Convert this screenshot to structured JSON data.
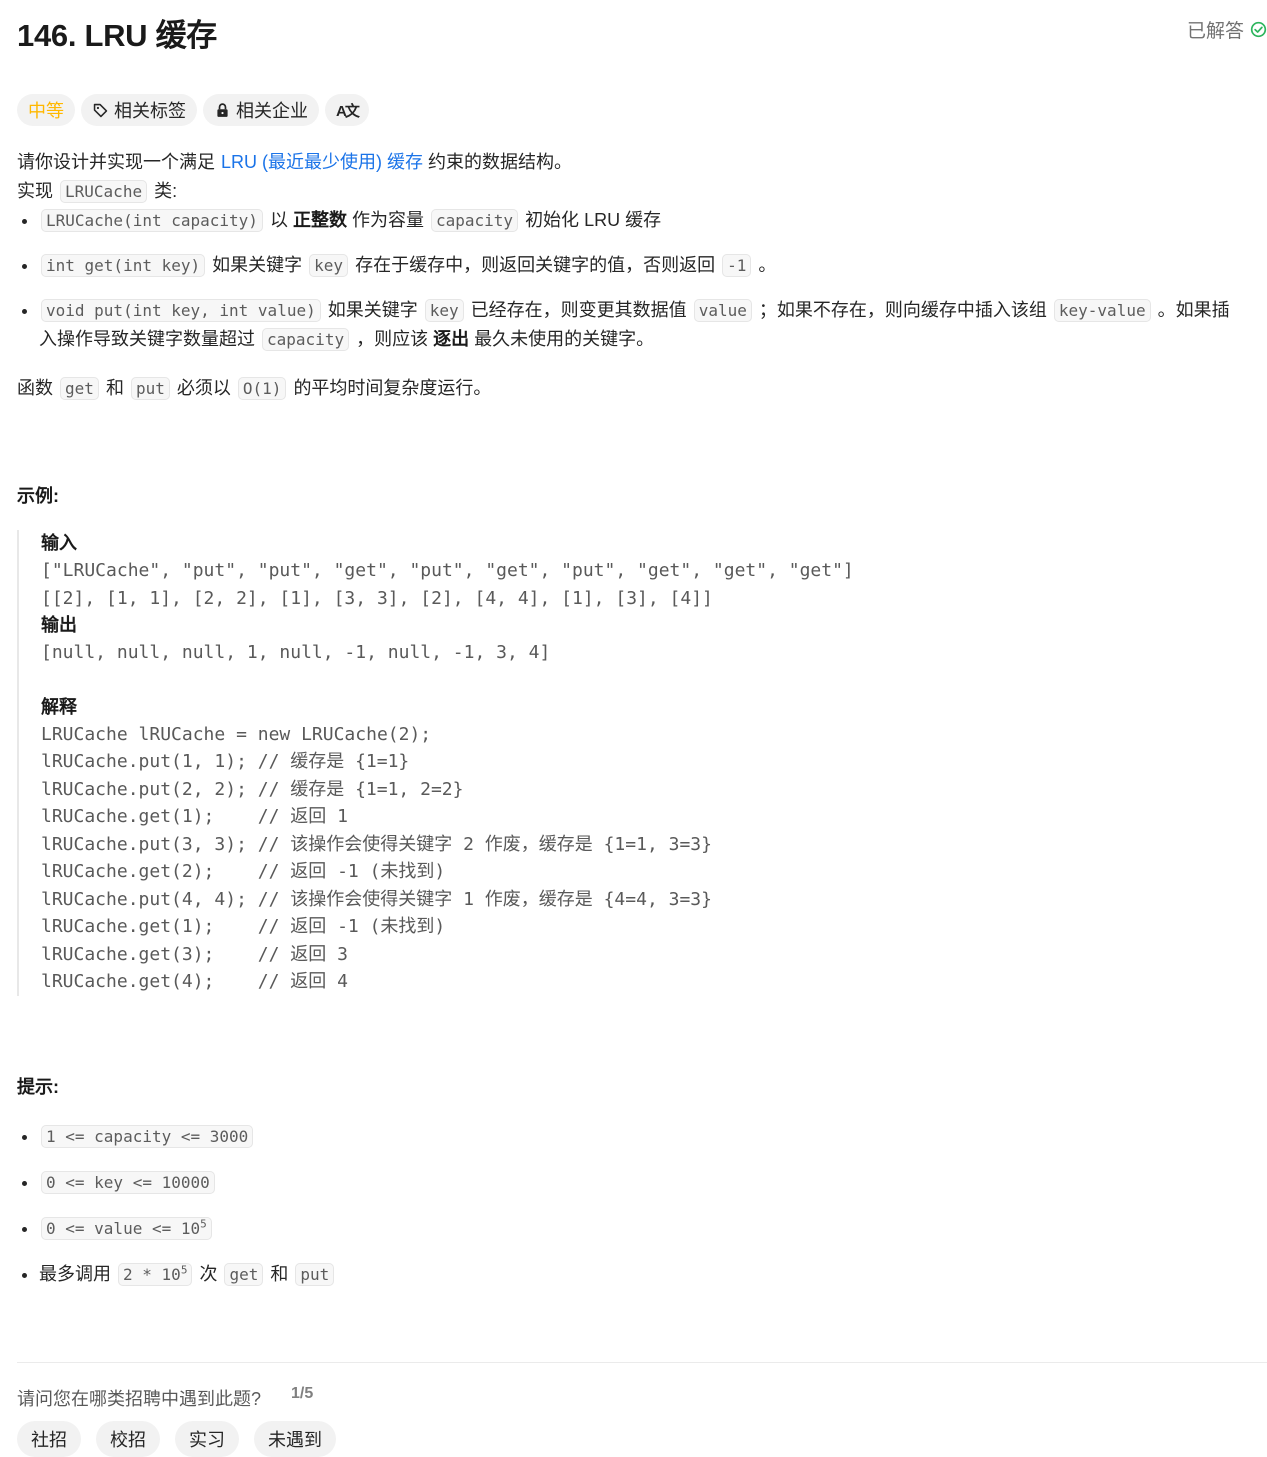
{
  "header": {
    "title": "146. LRU 缓存",
    "status_label": "已解答",
    "status_color": "#2db55d"
  },
  "tags": {
    "difficulty": "中等",
    "difficulty_color": "#ffb800",
    "topics": "相关标签",
    "companies": "相关企业",
    "translate_icon_text": "A文"
  },
  "description": {
    "intro_before": "请你设计并实现一个满足",
    "intro_link": "LRU (最近最少使用) 缓存",
    "intro_after": "约束的数据结构。",
    "impl_before": "实现",
    "impl_code": "LRUCache",
    "impl_after": "类:",
    "items": [
      {
        "code1": "LRUCache(int capacity)",
        "t1": "以",
        "bold": "正整数",
        "t2": "作为容量",
        "code2": "capacity",
        "t3": "初始化 LRU 缓存"
      },
      {
        "code1": "int get(int key)",
        "t1": "如果关键字",
        "code2": "key",
        "t2": "存在于缓存中，则返回关键字的值，否则返回",
        "code3": "-1",
        "t3": "。"
      },
      {
        "code1": "void put(int key, int value)",
        "t1": "如果关键字",
        "code2": "key",
        "t2": "已经存在，则变更其数据值",
        "code3": "value",
        "t3": "；如果不存在，则向缓存中插入该组",
        "code4": "key-value",
        "t4": "。如果插入操作导致关键字数量超过",
        "code5": "capacity",
        "t5": "，则应该",
        "bold": "逐出",
        "t6": "最久未使用的关键字。"
      }
    ],
    "complexity": {
      "t1": "函数",
      "code1": "get",
      "t2": "和",
      "code2": "put",
      "t3": "必须以",
      "code3": "O(1)",
      "t4": "的平均时间复杂度运行。"
    }
  },
  "example": {
    "heading": "示例:",
    "input_label": "输入",
    "input_lines": [
      "[\"LRUCache\", \"put\", \"put\", \"get\", \"put\", \"get\", \"put\", \"get\", \"get\", \"get\"]",
      "[[2], [1, 1], [2, 2], [1], [3, 3], [2], [4, 4], [1], [3], [4]]"
    ],
    "output_label": "输出",
    "output_line": "[null, null, null, 1, null, -1, null, -1, 3, 4]",
    "explain_label": "解释",
    "explain_lines": [
      "LRUCache lRUCache = new LRUCache(2);",
      "lRUCache.put(1, 1); // 缓存是 {1=1}",
      "lRUCache.put(2, 2); // 缓存是 {1=1, 2=2}",
      "lRUCache.get(1);    // 返回 1",
      "lRUCache.put(3, 3); // 该操作会使得关键字 2 作废，缓存是 {1=1, 3=3}",
      "lRUCache.get(2);    // 返回 -1 (未找到)",
      "lRUCache.put(4, 4); // 该操作会使得关键字 1 作废，缓存是 {4=4, 3=3}",
      "lRUCache.get(1);    // 返回 -1 (未找到)",
      "lRUCache.get(3);    // 返回 3",
      "lRUCache.get(4);    // 返回 4"
    ]
  },
  "hints": {
    "heading": "提示:",
    "c1": "1 <= capacity <= 3000",
    "c2": "0 <= key <= 10000",
    "c3_base": "0 <= value <= 10",
    "c3_exp": "5",
    "c4_t1": "最多调用",
    "c4_code_base": "2 * 10",
    "c4_code_exp": "5",
    "c4_t2": "次",
    "c4_code2": "get",
    "c4_t3": "和",
    "c4_code3": "put"
  },
  "survey": {
    "question": "请问您在哪类招聘中遇到此题?",
    "progress": "1/5",
    "options": [
      "社招",
      "校招",
      "实习",
      "未遇到"
    ]
  }
}
